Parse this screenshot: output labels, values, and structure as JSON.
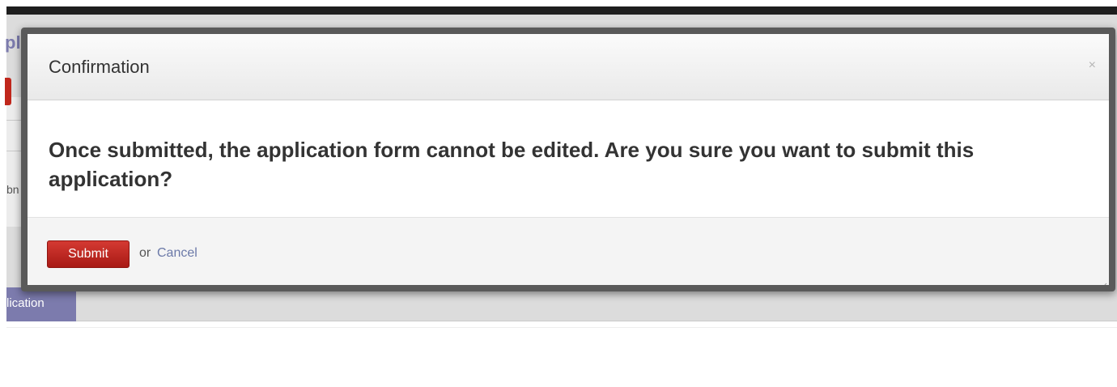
{
  "background": {
    "title_fragment": "pl",
    "field_fragment": "bn",
    "tab_label": "lication"
  },
  "modal": {
    "title": "Confirmation",
    "close_glyph": "×",
    "message": "Once submitted, the application form cannot be edited. Are you sure you want to submit this application?",
    "submit_label": "Submit",
    "or_text": "or",
    "cancel_label": "Cancel"
  },
  "colors": {
    "accent_purple": "#7c7bad",
    "submit_red": "#c0271c",
    "cancel_link": "#6b79a8"
  },
  "icons": {
    "close": "close-icon",
    "resize": "resize-handle-icon"
  }
}
